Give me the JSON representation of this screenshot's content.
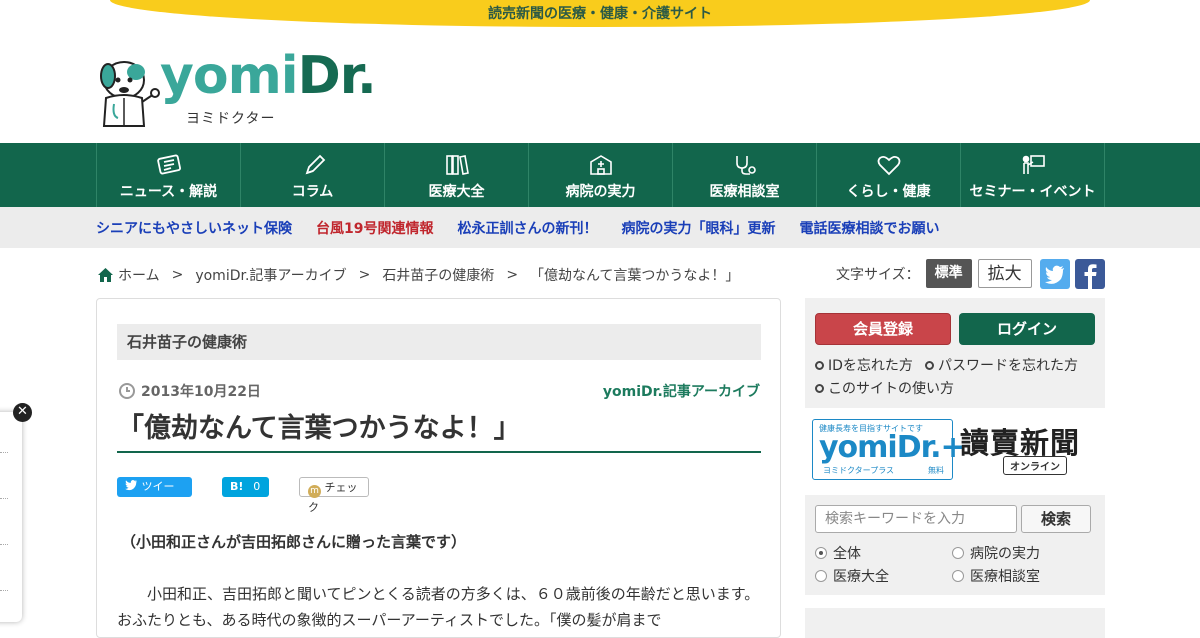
{
  "banner": {
    "text": "読売新聞の医療・健康・介護サイト"
  },
  "logo": {
    "name": "yomi",
    "name_dr": "Dr.",
    "sub": "ヨミドクター"
  },
  "nav": [
    {
      "label": "ニュース・解説",
      "icon": "newspaper-icon"
    },
    {
      "label": "コラム",
      "icon": "pencil-icon"
    },
    {
      "label": "医療大全",
      "icon": "books-icon"
    },
    {
      "label": "病院の実力",
      "icon": "hospital-icon"
    },
    {
      "label": "医療相談室",
      "icon": "stethoscope-icon"
    },
    {
      "label": "くらし・健康",
      "icon": "heart-icon"
    },
    {
      "label": "セミナー・イベント",
      "icon": "presenter-icon"
    }
  ],
  "sub_links": [
    {
      "label": "シニアにもやさしいネット保険",
      "color": "#1a3fb8"
    },
    {
      "label": "台風19号関連情報",
      "color": "#c0262d"
    },
    {
      "label": "松永正訓さんの新刊！",
      "color": "#1a3fb8"
    },
    {
      "label": "病院の実力「眼科」更新",
      "color": "#1a3fb8"
    },
    {
      "label": "電話医療相談でお願い",
      "color": "#1a3fb8"
    }
  ],
  "breadcrumb": {
    "home": "ホーム",
    "sep": ">",
    "items": [
      "yomiDr.記事アーカイブ",
      "石井苗子の健康術",
      "「億劫なんて言葉つかうなよ！」"
    ]
  },
  "font_size": {
    "label": "文字サイズ：",
    "standard": "標準",
    "large": "拡大"
  },
  "article": {
    "category": "石井苗子の健康術",
    "date": "2013年10月22日",
    "archive": "yomiDr.記事アーカイブ",
    "title": "「億劫なんて言葉つかうなよ！」",
    "share": {
      "tweet": "ツイート",
      "hatena": "B!",
      "hatena_count": "0",
      "check": "チェック"
    },
    "lead": "（小田和正さんが吉田拓郎さんに贈った言葉です）",
    "body": "小田和正、吉田拓郎と聞いてピンとくる読者の方多くは、６０歳前後の年齢だと思います。おふたりとも、ある時代の象徴的スーパーアーティストでした。「僕の髪が肩まで"
  },
  "sidebar": {
    "register": "会員登録",
    "login": "ログイン",
    "links": [
      "IDを忘れた方",
      "パスワードを忘れた方",
      "このサイトの使い方"
    ],
    "plus": {
      "small": "健康長寿を目指すサイトです",
      "big": "yomiDr.+",
      "sub": "ヨミドクタープラス",
      "free": "無料"
    },
    "yomiuri": {
      "name": "讀賣新聞",
      "online": "オンライン"
    },
    "search": {
      "placeholder": "検索キーワードを入力",
      "button": "検索",
      "options": [
        "全体",
        "病院の実力",
        "医療大全",
        "医療相談室"
      ],
      "selected": "全体"
    }
  },
  "colors": {
    "brand_green": "#12664c",
    "banner_yellow": "#f9cc1c",
    "logo_teal": "#3aa79a"
  }
}
